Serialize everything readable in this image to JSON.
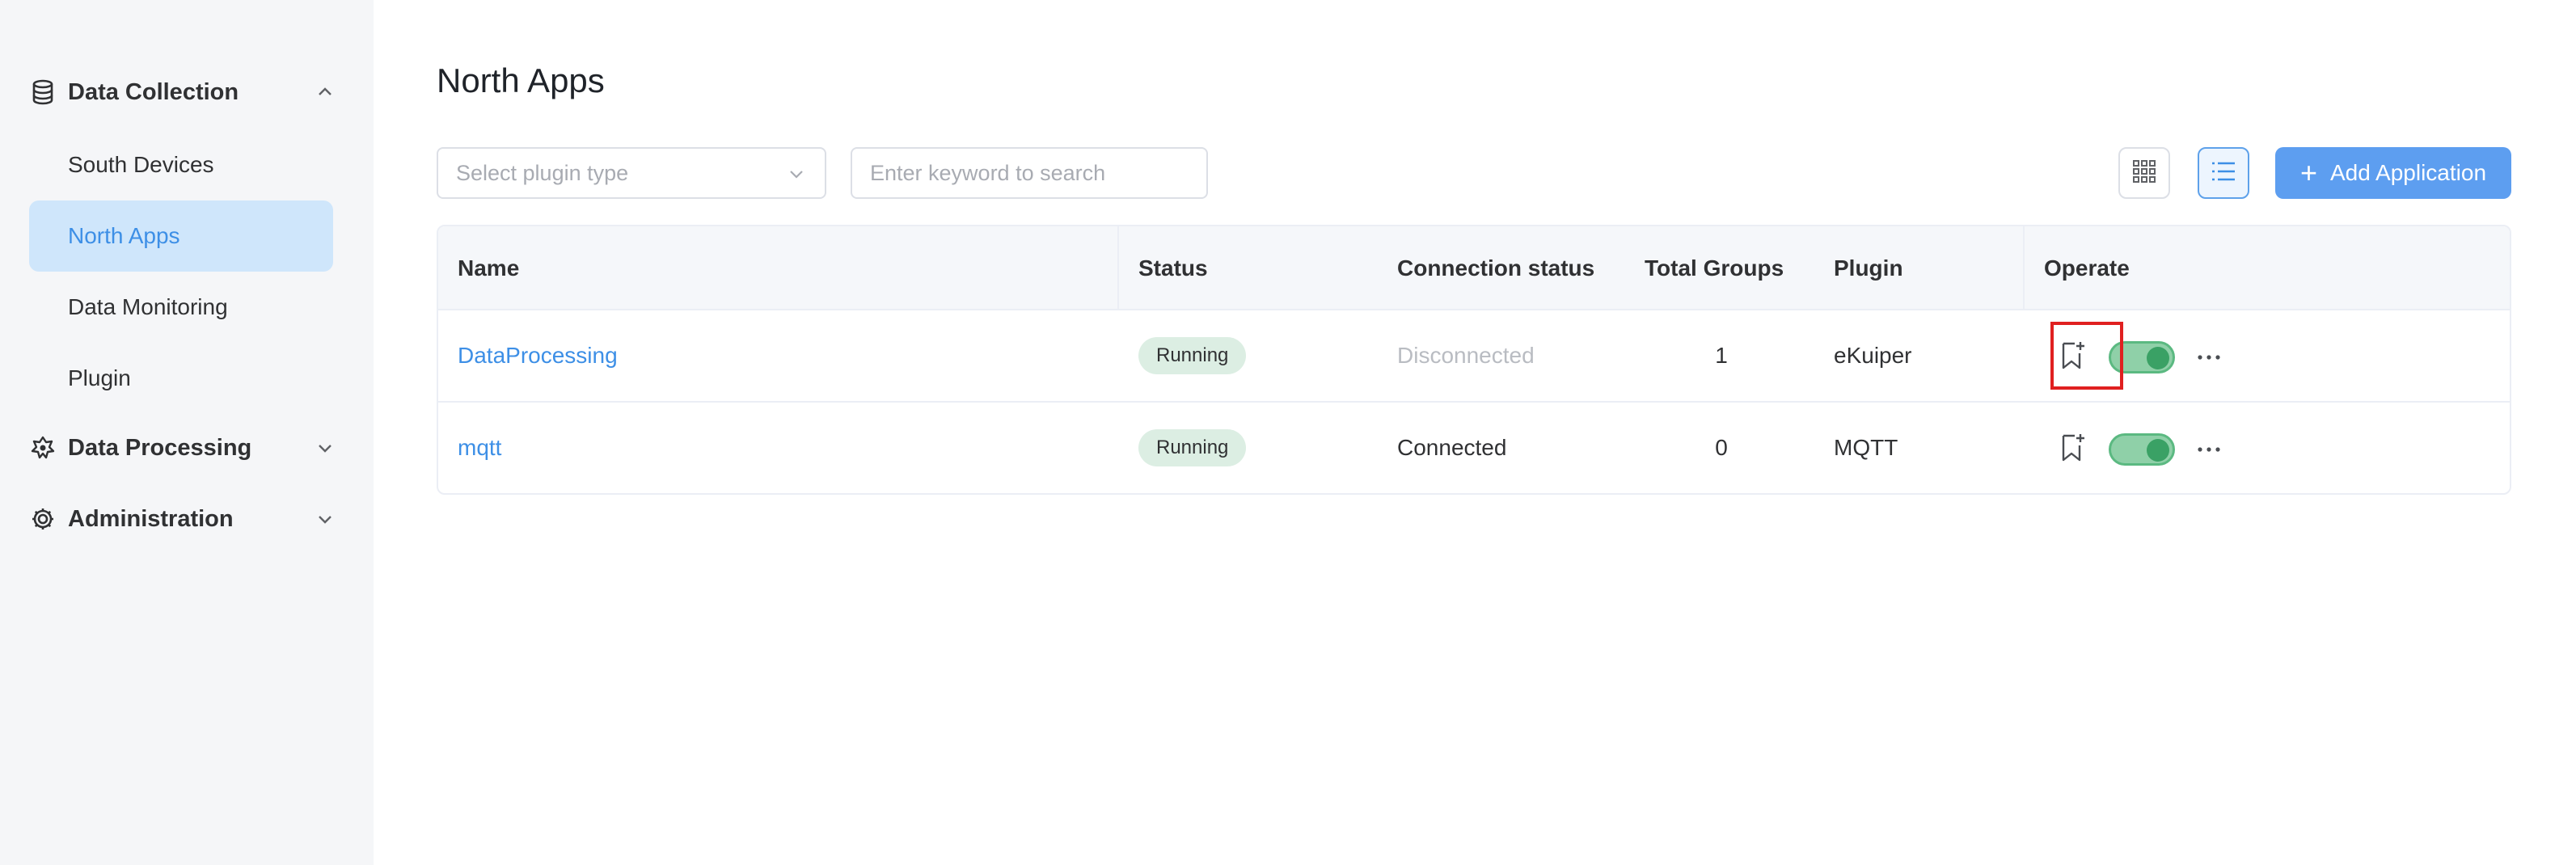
{
  "sidebar": {
    "data_collection": {
      "label": "Data Collection",
      "icon": "database-icon"
    },
    "items": [
      {
        "label": "South Devices",
        "active": false
      },
      {
        "label": "North Apps",
        "active": true
      },
      {
        "label": "Data Monitoring",
        "active": false
      },
      {
        "label": "Plugin",
        "active": false
      }
    ],
    "data_processing": {
      "label": "Data Processing",
      "icon": "gear-flow-icon"
    },
    "administration": {
      "label": "Administration",
      "icon": "settings-icon"
    }
  },
  "page": {
    "title": "North Apps"
  },
  "filters": {
    "plugin_placeholder": "Select plugin type",
    "search_placeholder": "Enter keyword to search"
  },
  "toolbar": {
    "add_label": "Add Application"
  },
  "table": {
    "headers": [
      "Name",
      "Status",
      "Connection status",
      "Total Groups",
      "Plugin",
      "Operate"
    ],
    "rows": [
      {
        "name": "DataProcessing",
        "status": "Running",
        "connection": "Disconnected",
        "groups": "1",
        "plugin": "eKuiper",
        "enabled": true
      },
      {
        "name": "mqtt",
        "status": "Running",
        "connection": "Connected",
        "groups": "0",
        "plugin": "MQTT",
        "enabled": true
      }
    ]
  },
  "colors": {
    "accent": "#3d8fe6",
    "running_bg": "#dceee3",
    "toggle_on": "#3aa165",
    "highlight": "#e02020"
  }
}
